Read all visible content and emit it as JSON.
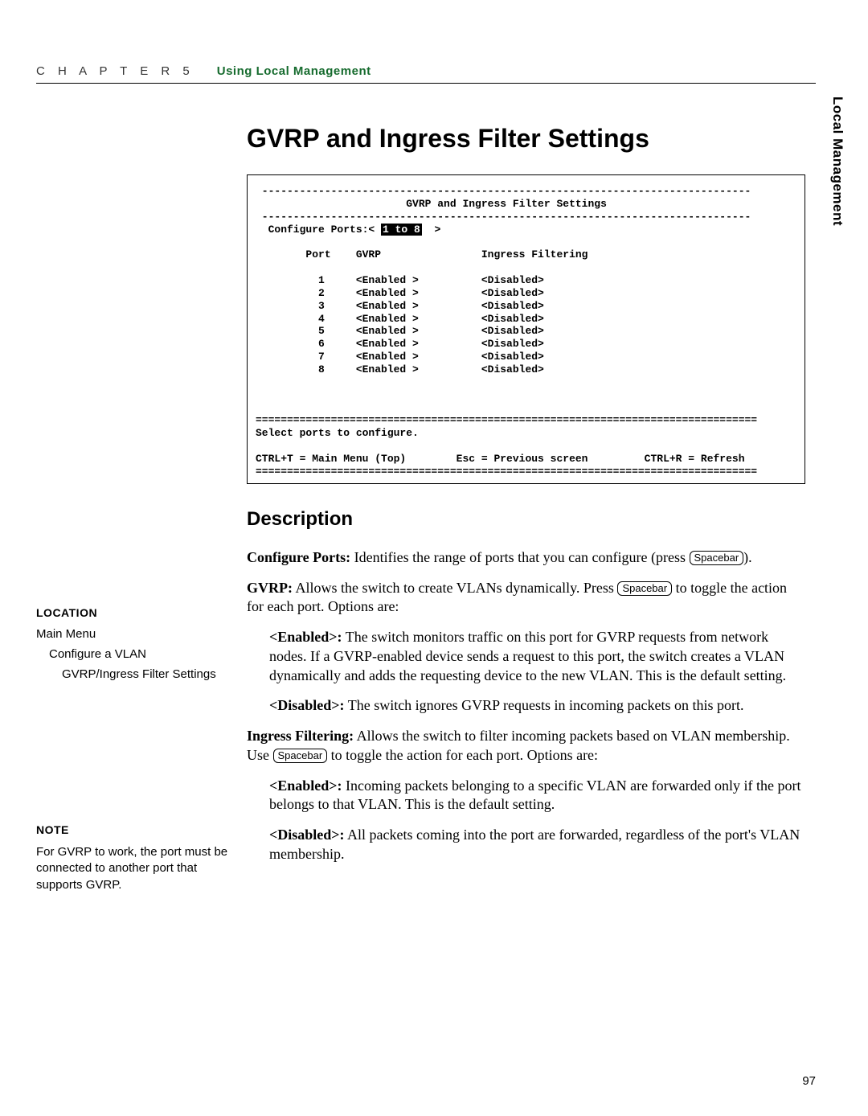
{
  "header": {
    "chapter": "C   H   A   P   T   E   R       5",
    "title": "Using Local Management"
  },
  "side_tab": "Local Management",
  "page_title": "GVRP and Ingress Filter Settings",
  "terminal": {
    "title": "GVRP and Ingress Filter Settings",
    "cfg_prefix": "Configure Ports:< ",
    "cfg_range": "1 to 8",
    "cfg_suffix": "  >",
    "cols": {
      "port": "Port",
      "gvrp": "GVRP",
      "ingress": "Ingress Filtering"
    },
    "rows": [
      {
        "port": "1",
        "gvrp": "<Enabled >",
        "ingress": "<Disabled>"
      },
      {
        "port": "2",
        "gvrp": "<Enabled >",
        "ingress": "<Disabled>"
      },
      {
        "port": "3",
        "gvrp": "<Enabled >",
        "ingress": "<Disabled>"
      },
      {
        "port": "4",
        "gvrp": "<Enabled >",
        "ingress": "<Disabled>"
      },
      {
        "port": "5",
        "gvrp": "<Enabled >",
        "ingress": "<Disabled>"
      },
      {
        "port": "6",
        "gvrp": "<Enabled >",
        "ingress": "<Disabled>"
      },
      {
        "port": "7",
        "gvrp": "<Enabled >",
        "ingress": "<Disabled>"
      },
      {
        "port": "8",
        "gvrp": "<Enabled >",
        "ingress": "<Disabled>"
      }
    ],
    "prompt": "Select ports to configure.",
    "hint_left": "CTRL+T = Main Menu (Top)",
    "hint_mid": "Esc = Previous screen",
    "hint_right": "CTRL+R = Refresh"
  },
  "desc_heading": "Description",
  "cfg_ports": {
    "label": "Configure Ports:",
    "text": " Identifies the range of ports that you can configure (press ",
    "tail": ")."
  },
  "gvrp": {
    "label": "GVRP:",
    "t1": " Allows the switch to create VLANs dynamically. Press ",
    "t2": " to toggle the action for each port. Options are:"
  },
  "gvrp_en": {
    "label": "<Enabled>:",
    "text": " The switch monitors traffic on this port for GVRP requests from network nodes. If a GVRP-enabled device sends a request to this port, the switch creates a VLAN dynamically and adds the requesting device to the new VLAN. This is the default setting."
  },
  "gvrp_dis": {
    "label": "<Disabled>:",
    "text": " The switch ignores GVRP requests in incoming packets on this port."
  },
  "ingress": {
    "label": "Ingress Filtering:",
    "t1": " Allows the switch to filter incoming packets based on VLAN membership. Use ",
    "t2": " to toggle the action for each port. Options are:"
  },
  "ing_en": {
    "label": "<Enabled>:",
    "text": " Incoming packets belonging to a specific VLAN are forwarded only if the port belongs to that VLAN. This is the default setting."
  },
  "ing_dis": {
    "label": "<Disabled>:",
    "text": " All packets coming into the port are forwarded, regardless of the port's VLAN membership."
  },
  "keycap": "Spacebar",
  "location": {
    "heading": "LOCATION",
    "l0": "Main Menu",
    "l1": "Configure a VLAN",
    "l2": "GVRP/Ingress Filter Settings"
  },
  "note": {
    "heading": "NOTE",
    "text": "For GVRP to work, the port must be connected to another port that supports GVRP."
  },
  "page_number": "97"
}
